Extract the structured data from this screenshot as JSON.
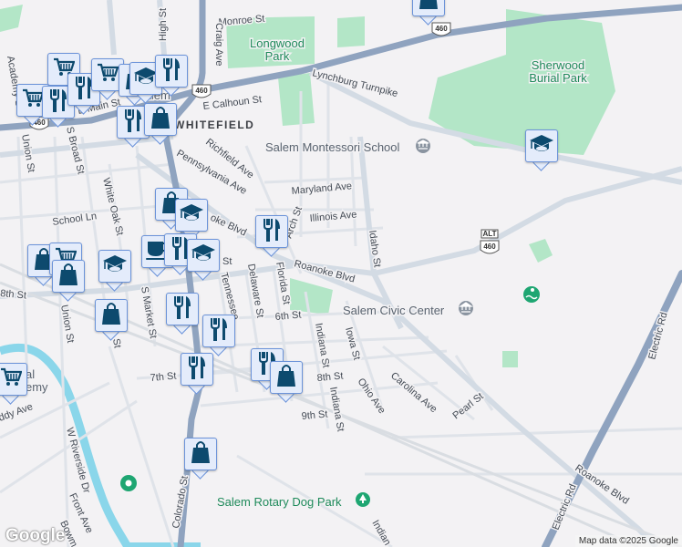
{
  "map": {
    "streets": [
      "Monroe St",
      "Craig Ave",
      "High St",
      "Lynchburg Turnpike",
      "E Calhoun St",
      "Richfield Ave",
      "Pennsylvania Ave",
      "Maryland Ave",
      "Illinois Ave",
      "Arch St",
      "School Ln",
      "White Oak St",
      "S Broad St",
      "Union St",
      "Union St",
      "Academy St",
      "E Main St",
      "Roanoke Blvd",
      "Roanoke Blvd",
      "oke Blvd",
      "Idaho St",
      "Tennessee",
      "Delaware St",
      "Florida St",
      "6th St",
      "S Market St",
      "Indiana St",
      "Indiana St",
      "Iowa St",
      "Ohio Ave",
      "Carolina Ave",
      "Pearl St",
      "8th St",
      "9th St",
      "7th St",
      "W Riverside Dr",
      "Front Ave",
      "Bowm",
      "ddy Ave",
      "Colorado St",
      "Electric Rd",
      "Electric Rd",
      "8th St",
      "Indian",
      "St",
      "St"
    ],
    "places": {
      "longwood_park": [
        "Longwood",
        "Park"
      ],
      "sherwood": [
        "Sherwood",
        "Burial Park"
      ],
      "montessori": "Salem Montessori School",
      "civic_center": "Salem Civic Center",
      "dog_park": "Salem Rotary Dog Park",
      "neighborhood": "WHITEFIELD",
      "town": "Salem",
      "academy": [
        "al",
        "emy"
      ]
    },
    "shields": [
      "460",
      "460",
      "460",
      "460"
    ],
    "shield_alt": "ALT",
    "markers": [
      "shopping-cart",
      "shopping-cart",
      "restaurant",
      "restaurant",
      "shopping-cart",
      "shopping-bag",
      "school",
      "restaurant",
      "restaurant",
      "shopping-bag",
      "school",
      "shopping-bag",
      "school",
      "restaurant",
      "shopping-bag",
      "shopping-cart",
      "shopping-bag",
      "school",
      "coffee",
      "restaurant",
      "school",
      "shopping-bag",
      "restaurant",
      "restaurant",
      "restaurant",
      "shopping-bag",
      "restaurant",
      "shopping-cart",
      "shopping-bag",
      "shopping-bag"
    ],
    "colors": {
      "marker_icon": "#0d4a6e",
      "marker_bg": "#e4ecfb",
      "marker_border": "#6b93d9",
      "highway": "#8fa3bf",
      "park": "#b3e6c7",
      "water": "#8ad6ea"
    }
  },
  "footer": {
    "logo": "Google",
    "attribution": "Map data ©2025 Google"
  }
}
